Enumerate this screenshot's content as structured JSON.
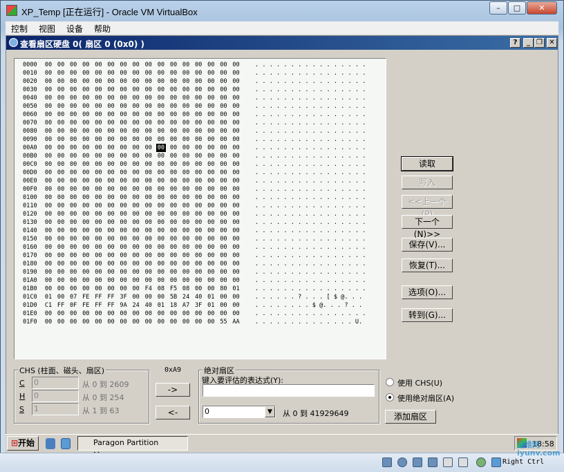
{
  "window": {
    "title": "XP_Temp [正在运行] - Oracle VM VirtualBox",
    "min": "–",
    "max": "□",
    "close": "✕"
  },
  "menu": [
    "控制",
    "视图",
    "设备",
    "帮助"
  ],
  "mdi": {
    "title": "查看扇区硬盘 0( 扇区 0 (0x0) )",
    "help": "?",
    "min": "_",
    "restore": "❐",
    "close": "✕"
  },
  "hex": {
    "rows": [
      {
        "addr": "0000",
        "bytes": [
          "00",
          "00",
          "00",
          "00",
          "00",
          "00",
          "00",
          "00",
          "00",
          "00",
          "00",
          "00",
          "00",
          "00",
          "00",
          "00"
        ],
        "ascii": ". . . . . . . . . . . . . . . ."
      },
      {
        "addr": "0010",
        "bytes": [
          "00",
          "00",
          "00",
          "00",
          "00",
          "00",
          "00",
          "00",
          "00",
          "00",
          "00",
          "00",
          "00",
          "00",
          "00",
          "00"
        ],
        "ascii": ". . . . . . . . . . . . . . . ."
      },
      {
        "addr": "0020",
        "bytes": [
          "00",
          "00",
          "00",
          "00",
          "00",
          "00",
          "00",
          "00",
          "00",
          "00",
          "00",
          "00",
          "00",
          "00",
          "00",
          "00"
        ],
        "ascii": ". . . . . . . . . . . . . . . ."
      },
      {
        "addr": "0030",
        "bytes": [
          "00",
          "00",
          "00",
          "00",
          "00",
          "00",
          "00",
          "00",
          "00",
          "00",
          "00",
          "00",
          "00",
          "00",
          "00",
          "00"
        ],
        "ascii": ". . . . . . . . . . . . . . . ."
      },
      {
        "addr": "0040",
        "bytes": [
          "00",
          "00",
          "00",
          "00",
          "00",
          "00",
          "00",
          "00",
          "00",
          "00",
          "00",
          "00",
          "00",
          "00",
          "00",
          "00"
        ],
        "ascii": ". . . . . . . . . . . . . . . ."
      },
      {
        "addr": "0050",
        "bytes": [
          "00",
          "00",
          "00",
          "00",
          "00",
          "00",
          "00",
          "00",
          "00",
          "00",
          "00",
          "00",
          "00",
          "00",
          "00",
          "00"
        ],
        "ascii": ". . . . . . . . . . . . . . . ."
      },
      {
        "addr": "0060",
        "bytes": [
          "00",
          "00",
          "00",
          "00",
          "00",
          "00",
          "00",
          "00",
          "00",
          "00",
          "00",
          "00",
          "00",
          "00",
          "00",
          "00"
        ],
        "ascii": ". . . . . . . . . . . . . . . ."
      },
      {
        "addr": "0070",
        "bytes": [
          "00",
          "00",
          "00",
          "00",
          "00",
          "00",
          "00",
          "00",
          "00",
          "00",
          "00",
          "00",
          "00",
          "00",
          "00",
          "00"
        ],
        "ascii": ". . . . . . . . . . . . . . . ."
      },
      {
        "addr": "0080",
        "bytes": [
          "00",
          "00",
          "00",
          "00",
          "00",
          "00",
          "00",
          "00",
          "00",
          "00",
          "00",
          "00",
          "00",
          "00",
          "00",
          "00"
        ],
        "ascii": ". . . . . . . . . . . . . . . ."
      },
      {
        "addr": "0090",
        "bytes": [
          "00",
          "00",
          "00",
          "00",
          "00",
          "00",
          "00",
          "00",
          "00",
          "00",
          "00",
          "00",
          "00",
          "00",
          "00",
          "00"
        ],
        "ascii": ". . . . . . . . . . . . . . . ."
      },
      {
        "addr": "00A0",
        "bytes": [
          "00",
          "00",
          "00",
          "00",
          "00",
          "00",
          "00",
          "00",
          "00",
          "00",
          "00",
          "00",
          "00",
          "00",
          "00",
          "00"
        ],
        "ascii": ". . . . . . . . . . . . . . . .",
        "sel": 9
      },
      {
        "addr": "00B0",
        "bytes": [
          "00",
          "00",
          "00",
          "00",
          "00",
          "00",
          "00",
          "00",
          "00",
          "00",
          "00",
          "00",
          "00",
          "00",
          "00",
          "00"
        ],
        "ascii": ". . . . . . . . . . . . . . . ."
      },
      {
        "addr": "00C0",
        "bytes": [
          "00",
          "00",
          "00",
          "00",
          "00",
          "00",
          "00",
          "00",
          "00",
          "00",
          "00",
          "00",
          "00",
          "00",
          "00",
          "00"
        ],
        "ascii": ". . . . . . . . . . . . . . . ."
      },
      {
        "addr": "00D0",
        "bytes": [
          "00",
          "00",
          "00",
          "00",
          "00",
          "00",
          "00",
          "00",
          "00",
          "00",
          "00",
          "00",
          "00",
          "00",
          "00",
          "00"
        ],
        "ascii": ". . . . . . . . . . . . . . . ."
      },
      {
        "addr": "00E0",
        "bytes": [
          "00",
          "00",
          "00",
          "00",
          "00",
          "00",
          "00",
          "00",
          "00",
          "00",
          "00",
          "00",
          "00",
          "00",
          "00",
          "00"
        ],
        "ascii": ". . . . . . . . . . . . . . . ."
      },
      {
        "addr": "00F0",
        "bytes": [
          "00",
          "00",
          "00",
          "00",
          "00",
          "00",
          "00",
          "00",
          "00",
          "00",
          "00",
          "00",
          "00",
          "00",
          "00",
          "00"
        ],
        "ascii": ". . . . . . . . . . . . . . . ."
      },
      {
        "addr": "0100",
        "bytes": [
          "00",
          "00",
          "00",
          "00",
          "00",
          "00",
          "00",
          "00",
          "00",
          "00",
          "00",
          "00",
          "00",
          "00",
          "00",
          "00"
        ],
        "ascii": ". . . . . . . . . . . . . . . ."
      },
      {
        "addr": "0110",
        "bytes": [
          "00",
          "00",
          "00",
          "00",
          "00",
          "00",
          "00",
          "00",
          "00",
          "00",
          "00",
          "00",
          "00",
          "00",
          "00",
          "00"
        ],
        "ascii": ". . . . . . . . . . . . . . . ."
      },
      {
        "addr": "0120",
        "bytes": [
          "00",
          "00",
          "00",
          "00",
          "00",
          "00",
          "00",
          "00",
          "00",
          "00",
          "00",
          "00",
          "00",
          "00",
          "00",
          "00"
        ],
        "ascii": ". . . . . . . . . . . . . . . ."
      },
      {
        "addr": "0130",
        "bytes": [
          "00",
          "00",
          "00",
          "00",
          "00",
          "00",
          "00",
          "00",
          "00",
          "00",
          "00",
          "00",
          "00",
          "00",
          "00",
          "00"
        ],
        "ascii": ". . . . . . . . . . . . . . . ."
      },
      {
        "addr": "0140",
        "bytes": [
          "00",
          "00",
          "00",
          "00",
          "00",
          "00",
          "00",
          "00",
          "00",
          "00",
          "00",
          "00",
          "00",
          "00",
          "00",
          "00"
        ],
        "ascii": ". . . . . . . . . . . . . . . ."
      },
      {
        "addr": "0150",
        "bytes": [
          "00",
          "00",
          "00",
          "00",
          "00",
          "00",
          "00",
          "00",
          "00",
          "00",
          "00",
          "00",
          "00",
          "00",
          "00",
          "00"
        ],
        "ascii": ". . . . . . . . . . . . . . . ."
      },
      {
        "addr": "0160",
        "bytes": [
          "00",
          "00",
          "00",
          "00",
          "00",
          "00",
          "00",
          "00",
          "00",
          "00",
          "00",
          "00",
          "00",
          "00",
          "00",
          "00"
        ],
        "ascii": ". . . . . . . . . . . . . . . ."
      },
      {
        "addr": "0170",
        "bytes": [
          "00",
          "00",
          "00",
          "00",
          "00",
          "00",
          "00",
          "00",
          "00",
          "00",
          "00",
          "00",
          "00",
          "00",
          "00",
          "00"
        ],
        "ascii": ". . . . . . . . . . . . . . . ."
      },
      {
        "addr": "0180",
        "bytes": [
          "00",
          "00",
          "00",
          "00",
          "00",
          "00",
          "00",
          "00",
          "00",
          "00",
          "00",
          "00",
          "00",
          "00",
          "00",
          "00"
        ],
        "ascii": ". . . . . . . . . . . . . . . ."
      },
      {
        "addr": "0190",
        "bytes": [
          "00",
          "00",
          "00",
          "00",
          "00",
          "00",
          "00",
          "00",
          "00",
          "00",
          "00",
          "00",
          "00",
          "00",
          "00",
          "00"
        ],
        "ascii": ". . . . . . . . . . . . . . . ."
      },
      {
        "addr": "01A0",
        "bytes": [
          "00",
          "00",
          "00",
          "00",
          "00",
          "00",
          "00",
          "00",
          "00",
          "00",
          "00",
          "00",
          "00",
          "00",
          "00",
          "00"
        ],
        "ascii": ". . . . . . . . . . . . . . . ."
      },
      {
        "addr": "01B0",
        "bytes": [
          "00",
          "00",
          "00",
          "00",
          "00",
          "00",
          "00",
          "00",
          "F4",
          "08",
          "F5",
          "08",
          "00",
          "00",
          "80",
          "01"
        ],
        "ascii": ". . . . . . . . . . . . . . . ."
      },
      {
        "addr": "01C0",
        "bytes": [
          "01",
          "00",
          "07",
          "FE",
          "FF",
          "FF",
          "3F",
          "00",
          "00",
          "00",
          "5B",
          "24",
          "40",
          "01",
          "00",
          "00"
        ],
        "ascii": ". . . . . . ? . . . [ $ @. . ."
      },
      {
        "addr": "01D0",
        "bytes": [
          "C1",
          "FF",
          "0F",
          "FE",
          "FF",
          "FF",
          "9A",
          "24",
          "40",
          "01",
          "18",
          "A7",
          "3F",
          "01",
          "00",
          "00"
        ],
        "ascii": ". . . . . . . . $ @. . . ? . ."
      },
      {
        "addr": "01E0",
        "bytes": [
          "00",
          "00",
          "00",
          "00",
          "00",
          "00",
          "00",
          "00",
          "00",
          "00",
          "00",
          "00",
          "00",
          "00",
          "00",
          "00"
        ],
        "ascii": ". . . . . . . . . . . . . . . ."
      },
      {
        "addr": "01F0",
        "bytes": [
          "00",
          "00",
          "00",
          "00",
          "00",
          "00",
          "00",
          "00",
          "00",
          "00",
          "00",
          "00",
          "00",
          "00",
          "55",
          "AA"
        ],
        "ascii": ". . . . . . . . . . . . . . U."
      }
    ]
  },
  "buttons": {
    "read": "读取",
    "write": "写入",
    "prev": "<<上一个(P)",
    "next": "下一个(N)>>",
    "save": "保存(V)...",
    "restore": "恢复(T)...",
    "options": "选项(O)...",
    "goto": "转到(G)..."
  },
  "chs": {
    "title": "CHS (柱面、磁头、扇区)",
    "rows": [
      {
        "label": "C",
        "value": "0",
        "range": "从 0 到 2609"
      },
      {
        "label": "H",
        "value": "0",
        "range": "从 0 到 254"
      },
      {
        "label": "S",
        "value": "1",
        "range": "从 1 到 63"
      }
    ]
  },
  "offset": "0xA9",
  "arrows": {
    "right": "->",
    "left": "<-"
  },
  "absolute": {
    "title": "绝对扇区",
    "expr_label": "键入要评估的表达式(Y):",
    "expr_value": "",
    "select_value": "0",
    "range": "从 0 到 41929649"
  },
  "radios": {
    "chs": "使用 CHS(U)",
    "abs": "使用绝对扇区(A)"
  },
  "add_sector": "添加扇区",
  "taskbar": {
    "start": "开始",
    "task": "Paragon Partition Manag...",
    "clock": "18:58"
  },
  "statusbar": {
    "hostkey": "Right Ctrl"
  },
  "watermark": "运维网 iyunv.com"
}
